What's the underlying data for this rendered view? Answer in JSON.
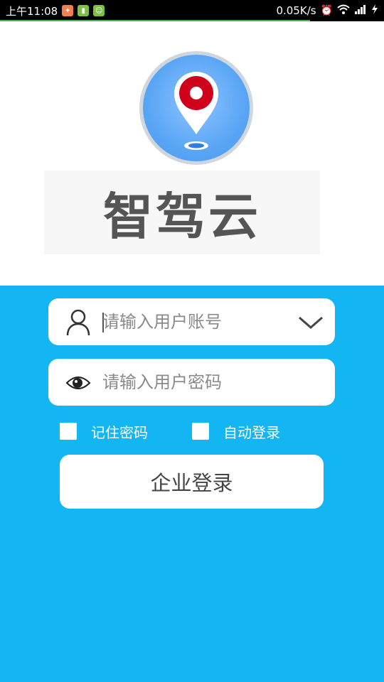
{
  "status_bar": {
    "time": "上午11:08",
    "network_speed": "0.05K/s",
    "notification_icons": [
      "weibo-icon",
      "battery-app-icon",
      "android-icon"
    ],
    "system_icons": [
      "alarm-icon",
      "wifi-icon",
      "signal-icon",
      "charging-icon"
    ]
  },
  "brand": {
    "name": "智驾云",
    "logo_icon": "map-pin-icon",
    "colors": {
      "pin": "#d0021b",
      "circle": "#5aa6f5"
    }
  },
  "login": {
    "username": {
      "placeholder": "请输入用户账号",
      "icon": "user-icon",
      "dropdown_icon": "chevron-down-icon"
    },
    "password": {
      "placeholder": "请输入用户密码",
      "icon": "eye-icon"
    },
    "remember_password": {
      "label": "记住密码",
      "checked": false
    },
    "auto_login": {
      "label": "自动登录",
      "checked": false
    },
    "submit_label": "企业登录",
    "background_color": "#13b5f3"
  }
}
